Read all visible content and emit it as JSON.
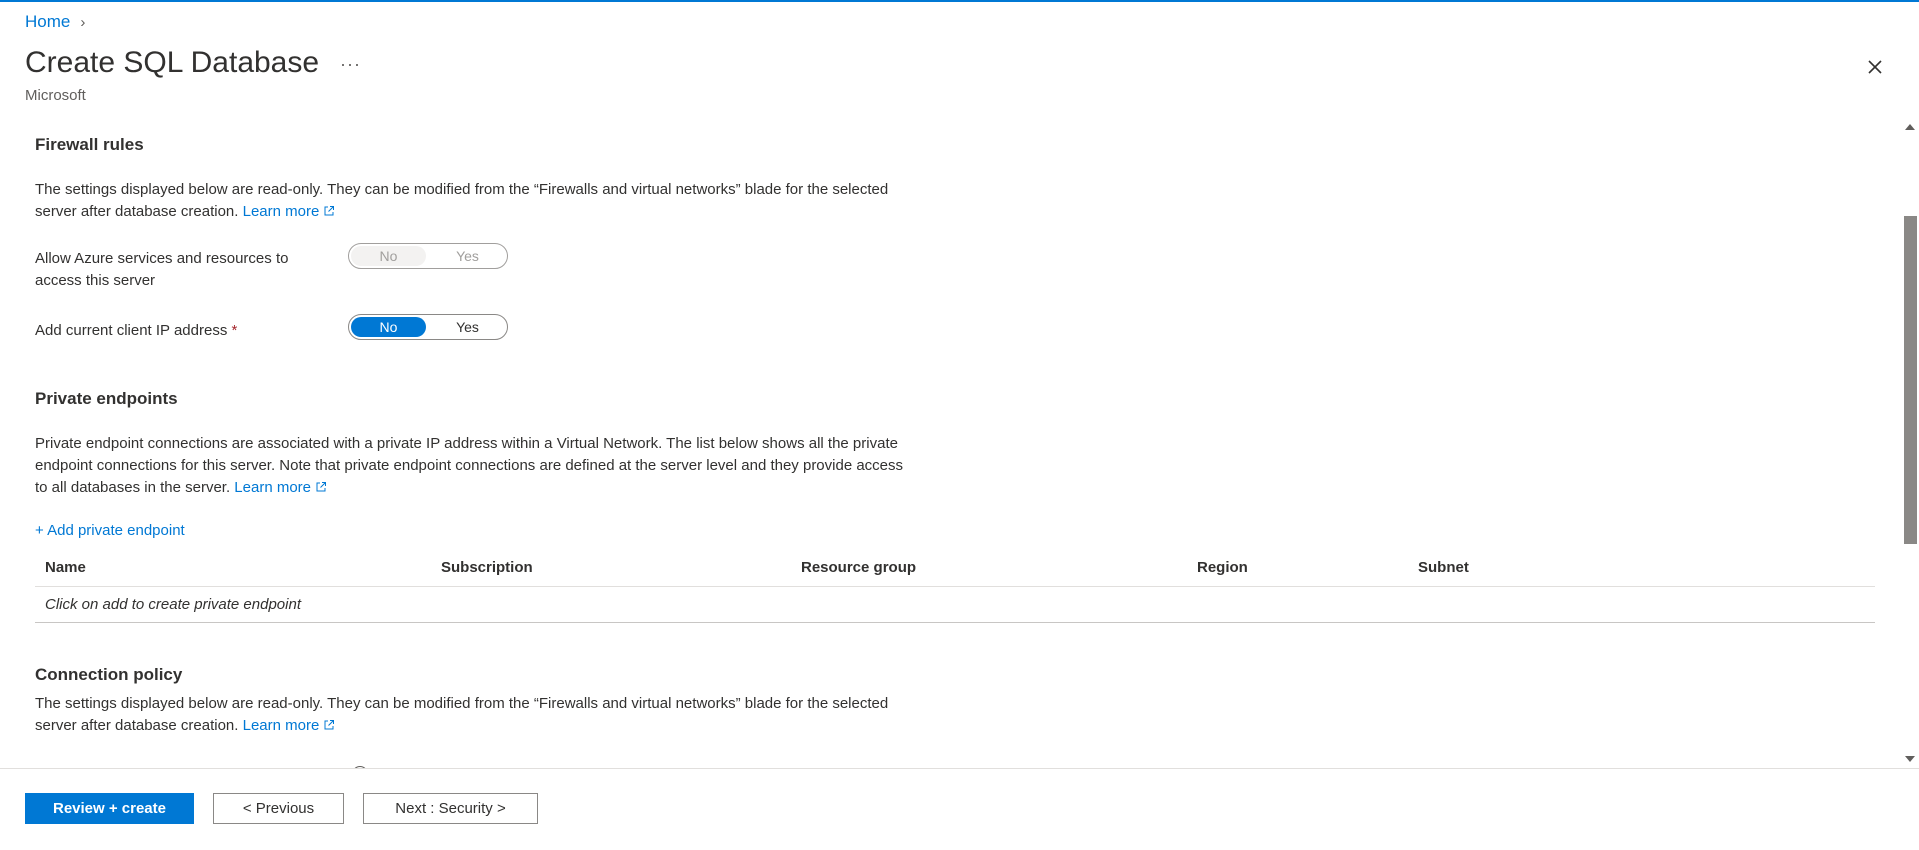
{
  "breadcrumb": {
    "home": "Home",
    "chevron": "›"
  },
  "header": {
    "title": "Create SQL Database",
    "more": "···",
    "subtitle": "Microsoft"
  },
  "firewall": {
    "title": "Firewall rules",
    "desc": "The settings displayed below are read-only. They can be modified from the “Firewalls and virtual networks” blade for the selected server after database creation.",
    "learn_more": "Learn more",
    "allow_azure": {
      "label": "Allow Azure services and resources to access this server",
      "no": "No",
      "yes": "Yes",
      "selected": "No",
      "disabled": true
    },
    "client_ip": {
      "label": "Add current client IP address",
      "required_mark": "*",
      "no": "No",
      "yes": "Yes",
      "selected": "No"
    }
  },
  "private_endpoints": {
    "title": "Private endpoints",
    "desc": "Private endpoint connections are associated with a private IP address within a Virtual Network. The list below shows all the private endpoint connections for this server. Note that private endpoint connections are defined at the server level and they provide access to all databases in the server.",
    "learn_more": "Learn more",
    "add_link": "+ Add private endpoint",
    "columns": [
      "Name",
      "Subscription",
      "Resource group",
      "Region",
      "Subnet"
    ],
    "empty_text": "Click on add to create private endpoint"
  },
  "connection_policy": {
    "title": "Connection policy",
    "desc": "The settings displayed below are read-only. They can be modified from the “Firewalls and virtual networks” blade for the selected server after database creation.",
    "learn_more": "Learn more"
  },
  "footer": {
    "review_create": "Review + create",
    "previous": "< Previous",
    "next": "Next : Security >"
  },
  "colors": {
    "accent": "#0078d4",
    "required": "#a4262c",
    "text": "#323130"
  }
}
